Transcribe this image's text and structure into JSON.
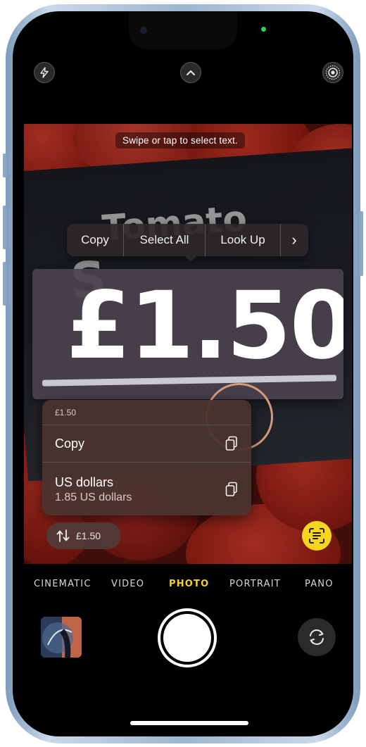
{
  "hint": {
    "text": "Swipe or tap to select text."
  },
  "sign_text": {
    "line1": "Tomato",
    "line2": "S"
  },
  "edit_menu": {
    "copy": "Copy",
    "select_all": "Select All",
    "look_up": "Look Up",
    "more": "›"
  },
  "detected": {
    "price": "£1.50"
  },
  "popup": {
    "header": "£1.50",
    "copy_label": "Copy",
    "conversion_title": "US dollars",
    "conversion_value": "1.85 US dollars"
  },
  "convert_chip": {
    "label": "£1.50"
  },
  "camera_modes": {
    "cinematic": "CINEMATIC",
    "video": "VIDEO",
    "photo": "PHOTO",
    "portrait": "PORTRAIT",
    "pano": "PANO"
  },
  "colors": {
    "accent_yellow": "#f6d51e",
    "active_mode": "#f7d22a",
    "indicator_green": "#34d15a"
  },
  "icons": {
    "flash": "flash-icon",
    "chevron": "chevron-up-icon",
    "live_photo": "live-photo-icon",
    "copy_doc": "copy-doc-icon",
    "convert": "currency-convert-icon",
    "live_text": "live-text-icon",
    "flip": "camera-flip-icon"
  }
}
